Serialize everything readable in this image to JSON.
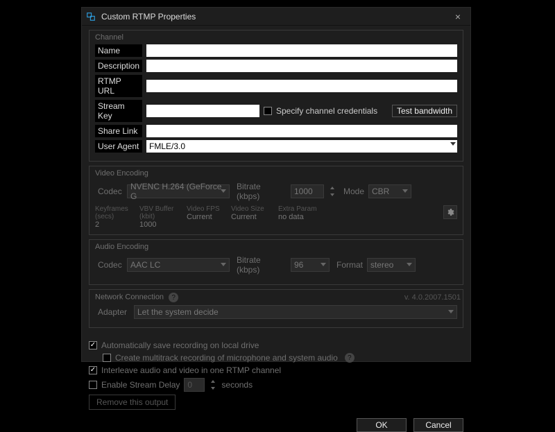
{
  "window": {
    "title": "Custom RTMP Properties"
  },
  "channel": {
    "legend": "Channel",
    "name_label": "Name",
    "name": "",
    "description_label": "Description",
    "description": "",
    "rtmp_url_label": "RTMP URL",
    "rtmp_url": "",
    "stream_key_label": "Stream Key",
    "stream_key": "",
    "specify_credentials_label": "Specify channel credentials",
    "test_bandwidth_label": "Test bandwidth",
    "share_link_label": "Share Link",
    "share_link": "",
    "user_agent_label": "User Agent",
    "user_agent": "FMLE/3.0"
  },
  "video": {
    "legend": "Video Encoding",
    "codec_label": "Codec",
    "codec": "NVENC H.264 (GeForce G",
    "bitrate_label": "Bitrate (kbps)",
    "bitrate": "1000",
    "mode_label": "Mode",
    "mode": "CBR",
    "keyframes_label": "Keyframes (secs)",
    "keyframes": "2",
    "vbv_label": "VBV Buffer (kbit)",
    "vbv": "1000",
    "fps_label": "Video FPS",
    "fps": "Current",
    "size_label": "Video Size",
    "size": "Current",
    "extra_label": "Extra Param",
    "extra": "no data"
  },
  "audio": {
    "legend": "Audio Encoding",
    "codec_label": "Codec",
    "codec": "AAC LC",
    "bitrate_label": "Bitrate (kbps)",
    "bitrate": "96",
    "format_label": "Format",
    "format": "stereo"
  },
  "network": {
    "legend": "Network Connection",
    "adapter_label": "Adapter",
    "adapter": "Let the system decide"
  },
  "footer": {
    "auto_save_label": "Automatically save recording on local drive",
    "multitrack_label": "Create multitrack recording of microphone and system audio",
    "interleave_label": "Interleave audio and video in one RTMP channel",
    "delay_label": "Enable Stream Delay",
    "delay_value": "0",
    "seconds_label": "seconds",
    "remove_label": "Remove this output",
    "version": "v. 4.0.2007.1501",
    "ok": "OK",
    "cancel": "Cancel"
  }
}
